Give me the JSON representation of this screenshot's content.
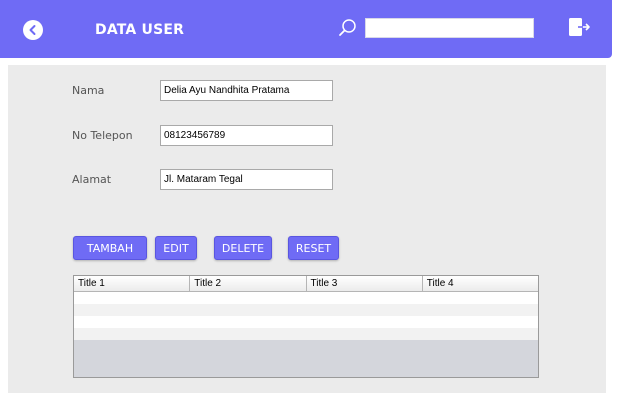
{
  "header": {
    "title": "DATA USER",
    "back_icon": "chevron-left-icon",
    "search_icon": "search-icon",
    "logout_icon": "logout-icon",
    "search_value": "",
    "accent_color": "#6f6bf5"
  },
  "form": {
    "nama_label": "Nama",
    "nama_value": "Delia Ayu Nandhita Pratama",
    "telepon_label": "No Telepon",
    "telepon_value": "08123456789",
    "alamat_label": "Alamat",
    "alamat_value": "Jl. Mataram Tegal"
  },
  "buttons": {
    "tambah": "TAMBAH",
    "edit": "EDIT",
    "delete": "DELETE",
    "reset": "RESET"
  },
  "table": {
    "columns": [
      "Title 1",
      "Title 2",
      "Title 3",
      "Title 4"
    ],
    "rows": [
      [
        "",
        "",
        "",
        ""
      ],
      [
        "",
        "",
        "",
        ""
      ],
      [
        "",
        "",
        "",
        ""
      ],
      [
        "",
        "",
        "",
        ""
      ]
    ]
  }
}
